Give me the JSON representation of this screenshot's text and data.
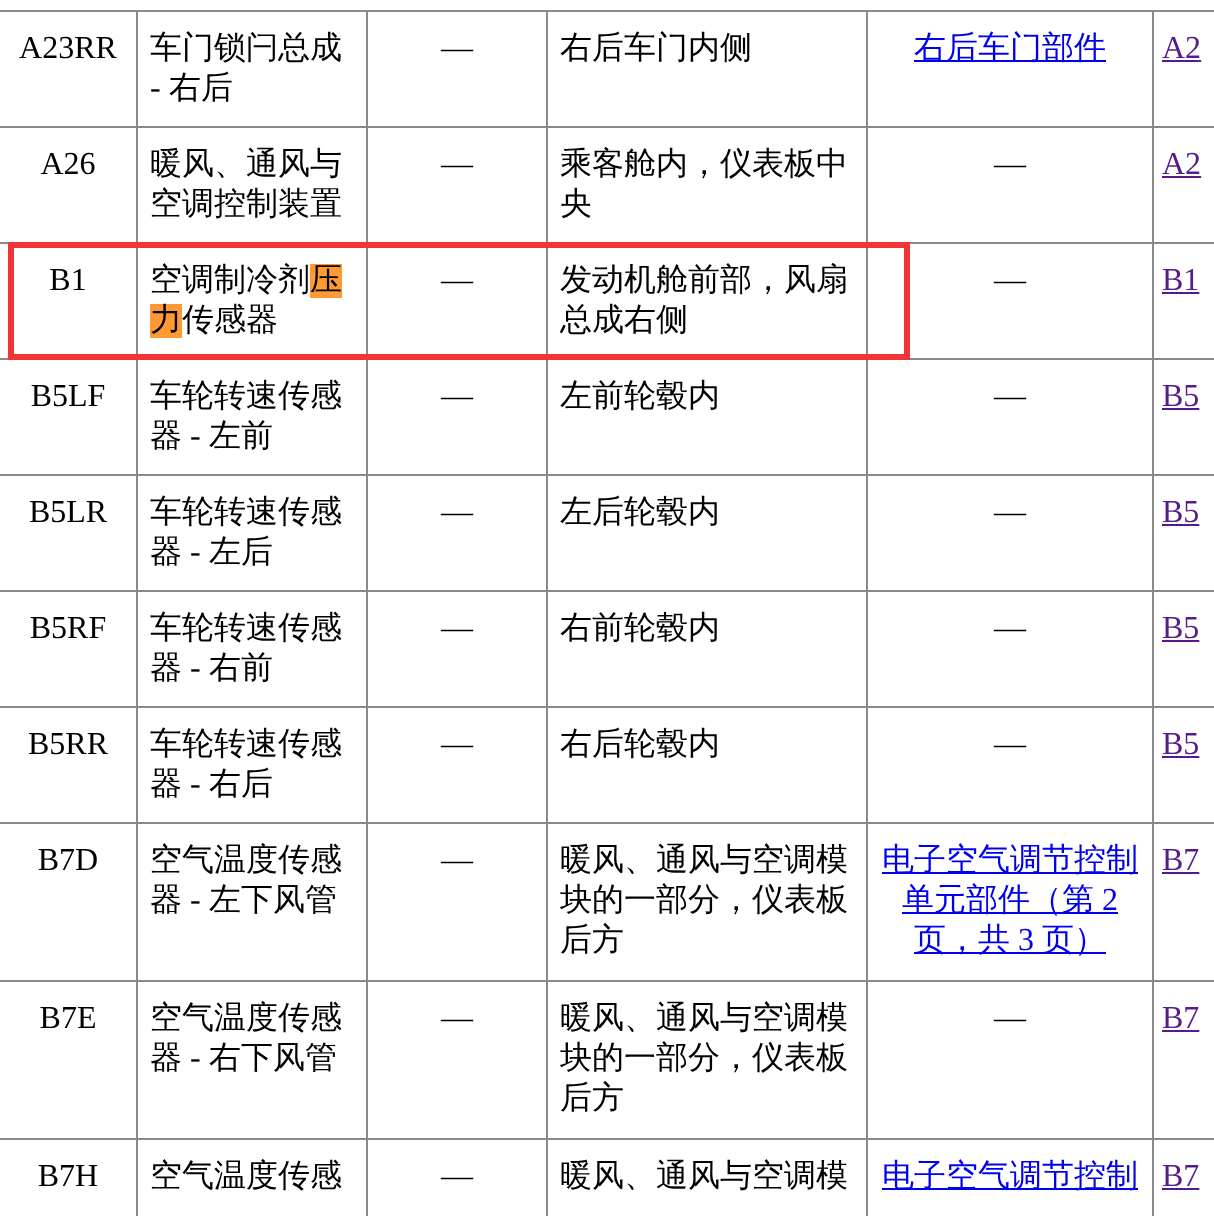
{
  "rows": [
    {
      "code": "A23RR",
      "name": [
        {
          "text": "车门锁闩总成 - 右后",
          "highlighted": false
        }
      ],
      "dash": "—",
      "location": "右后车门内侧",
      "component": {
        "kind": "link",
        "text": "右后车门部件"
      },
      "column_6": "A2",
      "outlined": false
    },
    {
      "code": "A26",
      "name": [
        {
          "text": "暖风、通风与空调控制装置",
          "highlighted": false
        }
      ],
      "dash": "—",
      "location": "乘客舱内，仪表板中央",
      "component": {
        "kind": "text",
        "text": "—"
      },
      "column_6": "A2",
      "outlined": false
    },
    {
      "code": "B1",
      "name": [
        {
          "text": "空调制冷剂",
          "highlighted": false
        },
        {
          "text": "压力",
          "highlighted": true
        },
        {
          "text": "传感器",
          "highlighted": false
        }
      ],
      "dash": "—",
      "location": "发动机舱前部，风扇总成右侧",
      "component": {
        "kind": "text",
        "text": "—"
      },
      "column_6": "B1",
      "outlined": true
    },
    {
      "code": "B5LF",
      "name": [
        {
          "text": "车轮转速传感器 - 左前",
          "highlighted": false
        }
      ],
      "dash": "—",
      "location": "左前轮毂内",
      "component": {
        "kind": "text",
        "text": "—"
      },
      "column_6": "B5",
      "outlined": false
    },
    {
      "code": "B5LR",
      "name": [
        {
          "text": "车轮转速传感器 - 左后",
          "highlighted": false
        }
      ],
      "dash": "—",
      "location": "左后轮毂内",
      "component": {
        "kind": "text",
        "text": "—"
      },
      "column_6": "B5",
      "outlined": false
    },
    {
      "code": "B5RF",
      "name": [
        {
          "text": "车轮转速传感器 - 右前",
          "highlighted": false
        }
      ],
      "dash": "—",
      "location": "右前轮毂内",
      "component": {
        "kind": "text",
        "text": "—"
      },
      "column_6": "B5",
      "outlined": false
    },
    {
      "code": "B5RR",
      "name": [
        {
          "text": "车轮转速传感器 - 右后",
          "highlighted": false
        }
      ],
      "dash": "—",
      "location": "右后轮毂内",
      "component": {
        "kind": "text",
        "text": "—"
      },
      "column_6": "B5",
      "outlined": false
    },
    {
      "code": "B7D",
      "name": [
        {
          "text": "空气温度传感器 - 左下风管",
          "highlighted": false
        }
      ],
      "dash": "—",
      "location": "暖风、通风与空调模块的一部分，仪表板后方",
      "component": {
        "kind": "link",
        "text": "电子空气调节控制单元部件（第 2 页，共 3 页）"
      },
      "column_6": "B7",
      "outlined": false
    },
    {
      "code": "B7E",
      "name": [
        {
          "text": "空气温度传感器 - 右下风管",
          "highlighted": false
        }
      ],
      "dash": "—",
      "location": "暖风、通风与空调模块的一部分，仪表板后方",
      "component": {
        "kind": "text",
        "text": "—"
      },
      "column_6": "B7",
      "outlined": false
    },
    {
      "code": "B7H",
      "name": [
        {
          "text": "空气温度传感",
          "highlighted": false
        }
      ],
      "dash": "—",
      "location": "暖风、通风与空调模",
      "component": {
        "kind": "link",
        "text": "电子空气调节控制"
      },
      "column_6": "B7",
      "outlined": false
    }
  ]
}
